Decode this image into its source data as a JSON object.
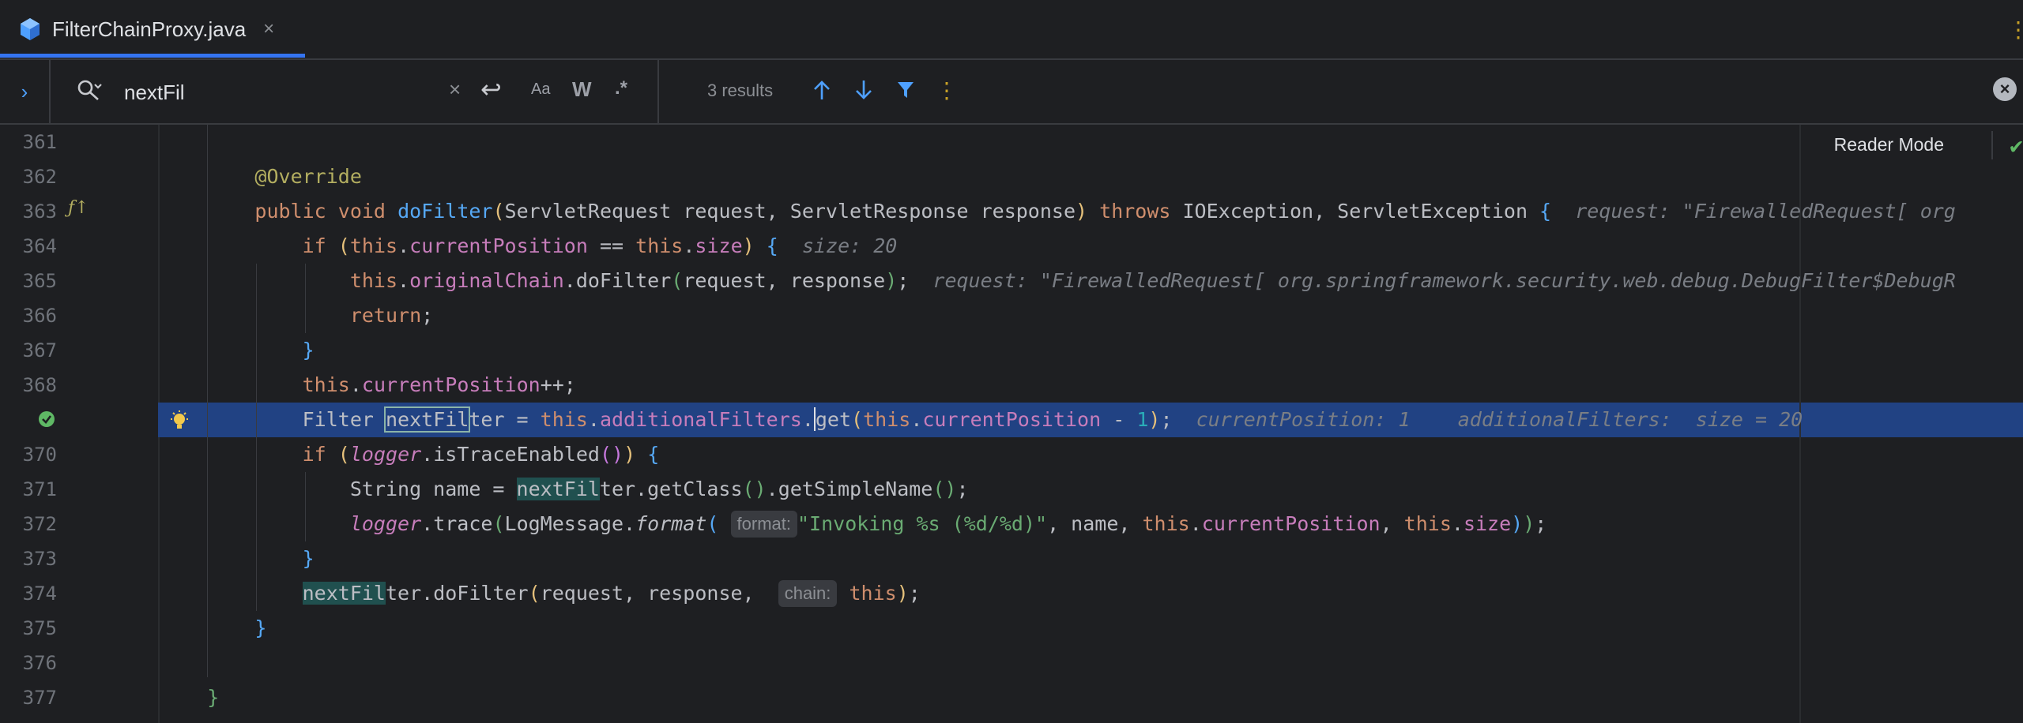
{
  "tab": {
    "title": "FilterChainProxy.java",
    "close": "×"
  },
  "find": {
    "query": "nextFil",
    "clear": "×",
    "newline": "↩",
    "match_case": "Aa",
    "words": "W",
    "regex": ".*",
    "result_count": "3 results"
  },
  "editor": {
    "reader_mode": "Reader Mode",
    "line_numbers": [
      "361",
      "362",
      "363",
      "364",
      "365",
      "366",
      "367",
      "368",
      "",
      "370",
      "371",
      "372",
      "373",
      "374",
      "375",
      "376",
      "377"
    ],
    "hints": {
      "l363": "request: \"FirewalledRequest[ org",
      "l364": "size: 20",
      "l365": "request: \"FirewalledRequest[ org.springframework.security.web.debug.DebugFilter$DebugR",
      "l369a": "currentPosition: 1",
      "l369b": "additionalFilters:  size = 20",
      "format_param": "format:",
      "chain_param": "chain:"
    }
  },
  "colors": {
    "accent": "#3574f0",
    "selection": "#214283",
    "background": "#1e1f22"
  }
}
